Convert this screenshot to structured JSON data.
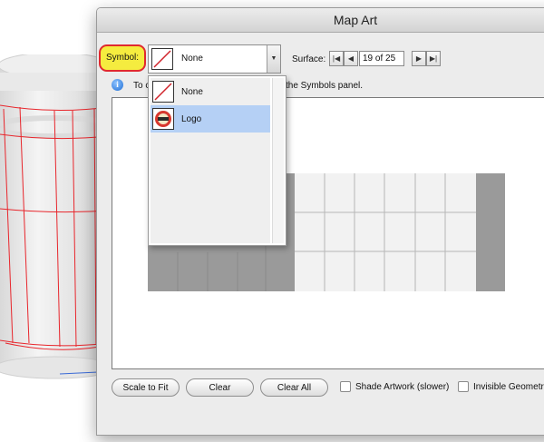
{
  "window": {
    "title": "Map Art"
  },
  "symbol": {
    "label": "Symbol:",
    "selected": "None",
    "options": [
      {
        "label": "None",
        "icon": "none-symbol-icon"
      },
      {
        "label": "Logo",
        "icon": "logo-symbol-icon"
      }
    ]
  },
  "surface": {
    "label": "Surface:",
    "count": "19 of 25"
  },
  "info": {
    "icon": "info-icon",
    "text_visible_start": "To c",
    "text_visible_end": "the Symbols panel."
  },
  "buttons": {
    "scale_to_fit": "Scale to Fit",
    "clear": "Clear",
    "clear_all": "Clear All"
  },
  "checkboxes": {
    "shade_artwork": {
      "label": "Shade Artwork (slower)",
      "checked": false
    },
    "invisible_geometry": {
      "label": "Invisible Geometr",
      "checked": false
    }
  },
  "colors": {
    "highlight_fill": "#f5ec3f",
    "highlight_border": "#e0292e",
    "wireframe": "#e8262c",
    "selection": "#b5d0f5"
  }
}
